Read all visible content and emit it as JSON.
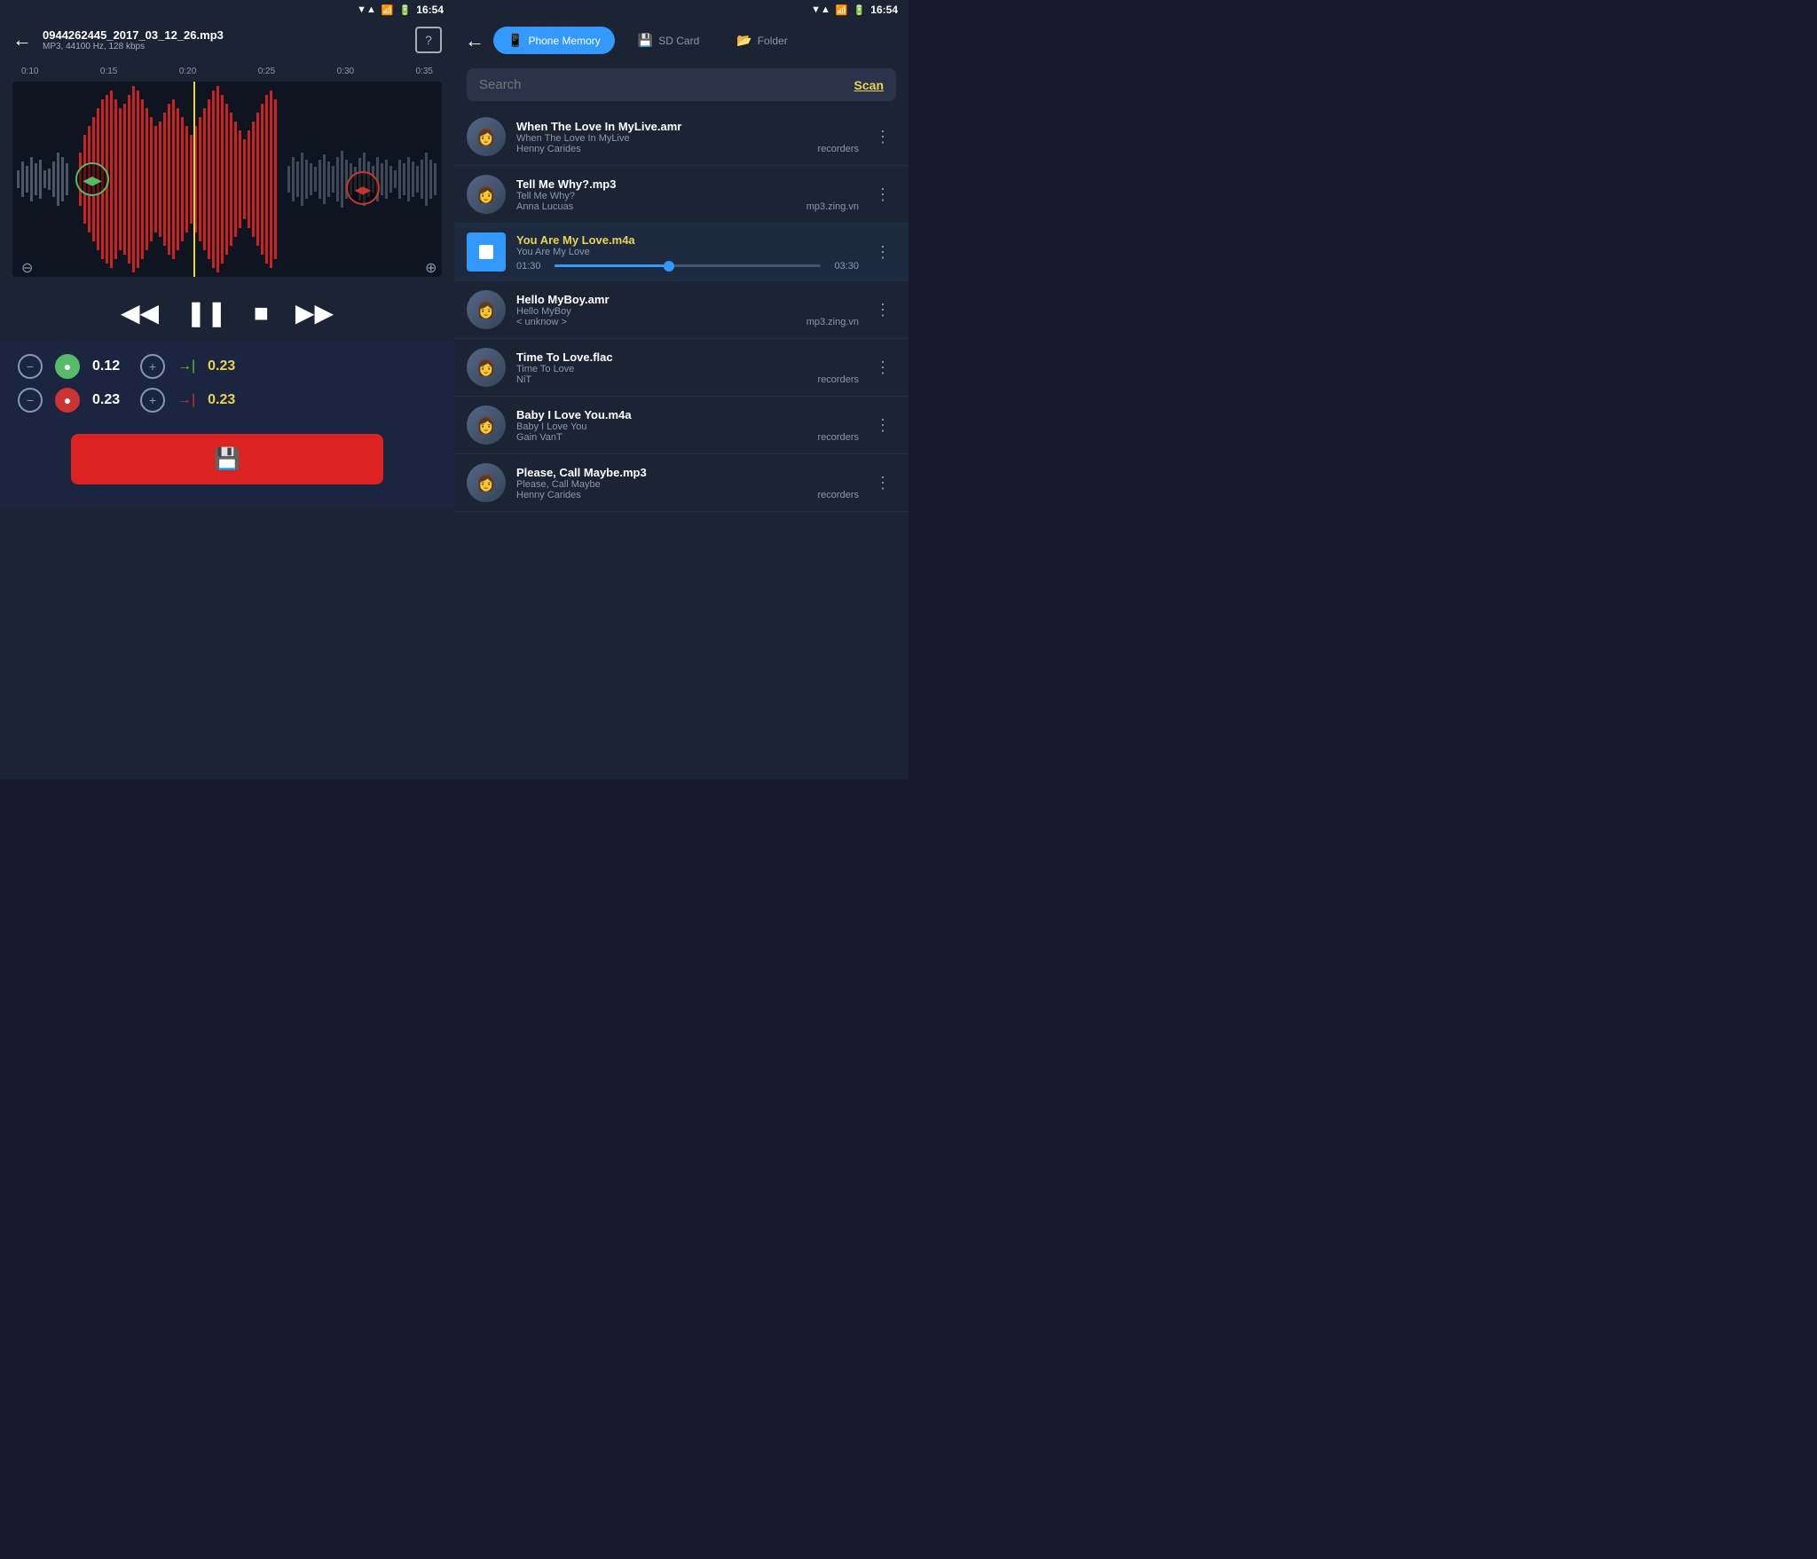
{
  "left": {
    "status": {
      "time": "16:54"
    },
    "header": {
      "back_label": "←",
      "file_name": "0944262445_2017_03_12_26.mp3",
      "file_meta": "MP3, 44100 Hz, 128 kbps",
      "file_icon": "?"
    },
    "timeline": {
      "marks": [
        "0:10",
        "0:15",
        "0:20",
        "0:25",
        "0:30",
        "0:35"
      ]
    },
    "transport": {
      "rewind": "◀◀",
      "pause": "❚❚",
      "stop": "■",
      "forward": "▶▶"
    },
    "edit": {
      "row1": {
        "minus": "−",
        "dot_green": "●",
        "value": "0.12",
        "plus": "+",
        "arrow": "→| ",
        "time": "0.23"
      },
      "row2": {
        "minus": "−",
        "dot_red": "●",
        "value": "0.23",
        "plus": "+",
        "arrow": "→|",
        "time": "0.23"
      },
      "save_label": "💾"
    }
  },
  "right": {
    "status": {
      "time": "16:54"
    },
    "header": {
      "back_label": "←",
      "tabs": [
        {
          "label": "Phone Memory",
          "icon": "📱",
          "active": true
        },
        {
          "label": "SD Card",
          "icon": "💾",
          "active": false
        },
        {
          "label": "Folder",
          "icon": "📂",
          "active": false
        }
      ]
    },
    "search": {
      "placeholder": "Search",
      "scan_label": "Scan"
    },
    "songs": [
      {
        "title": "When The Love In MyLive.amr",
        "subtitle": "When The Love In MyLive",
        "artist": "Henny Carides",
        "source": "recorders",
        "playing": false,
        "active": false
      },
      {
        "title": "Tell Me Why?.mp3",
        "subtitle": "Tell Me Why?",
        "artist": "Anna Lucuas",
        "source": "mp3.zing.vn",
        "playing": false,
        "active": false
      },
      {
        "title": "You Are My Love.m4a",
        "subtitle": "You Are My Love",
        "artist": "",
        "source": "",
        "playing": true,
        "active": true,
        "progress_current": "01:30",
        "progress_total": "03:30",
        "progress_pct": 43
      },
      {
        "title": "Hello MyBoy.amr",
        "subtitle": "Hello MyBoy",
        "artist": "< unknow >",
        "source": "mp3.zing.vn",
        "playing": false,
        "active": false
      },
      {
        "title": "Time To Love.flac",
        "subtitle": "Time To Love",
        "artist": "NiT",
        "source": "recorders",
        "playing": false,
        "active": false
      },
      {
        "title": "Baby I Love You.m4a",
        "subtitle": "Baby I Love You",
        "artist": "Gain VanT",
        "source": "recorders",
        "playing": false,
        "active": false
      },
      {
        "title": "Please, Call Maybe.mp3",
        "subtitle": "Please, Call Maybe",
        "artist": "Henny Carides",
        "source": "recorders",
        "playing": false,
        "active": false
      }
    ]
  }
}
